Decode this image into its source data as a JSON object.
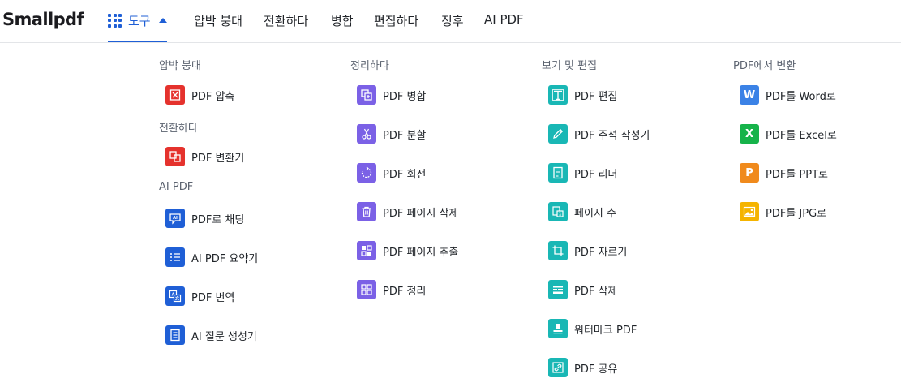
{
  "brand": {
    "logo": "Smallpdf"
  },
  "nav": {
    "tools_label": "도구",
    "items": [
      "압박 붕대",
      "전환하다",
      "병합",
      "편집하다",
      "징후",
      "AI PDF"
    ]
  },
  "menu": {
    "col1": {
      "sections": [
        {
          "title": "압박 붕대",
          "items": [
            {
              "label": "PDF 압축",
              "icon": "compress-icon"
            }
          ]
        },
        {
          "title": "전환하다",
          "items": [
            {
              "label": "PDF 변환기",
              "icon": "convert-icon"
            }
          ]
        },
        {
          "title": "AI PDF",
          "items": [
            {
              "label": "PDF로 채팅",
              "icon": "chat-ai-icon"
            },
            {
              "label": "AI PDF 요약기",
              "icon": "list-icon"
            },
            {
              "label": "PDF 번역",
              "icon": "translate-icon"
            },
            {
              "label": "AI 질문 생성기",
              "icon": "question-doc-icon"
            }
          ]
        }
      ]
    },
    "col2": {
      "title": "정리하다",
      "items": [
        {
          "label": "PDF 병합",
          "icon": "merge-icon"
        },
        {
          "label": "PDF 분할",
          "icon": "scissors-icon"
        },
        {
          "label": "PDF 회전",
          "icon": "rotate-icon"
        },
        {
          "label": "PDF 페이지 삭제",
          "icon": "trash-icon"
        },
        {
          "label": "PDF 페이지 추출",
          "icon": "extract-icon"
        },
        {
          "label": "PDF 정리",
          "icon": "organize-icon"
        }
      ]
    },
    "col3": {
      "title": "보기 및 편집",
      "items": [
        {
          "label": "PDF 편집",
          "icon": "text-icon"
        },
        {
          "label": "PDF 주석 작성기",
          "icon": "pen-icon"
        },
        {
          "label": "PDF 리더",
          "icon": "reader-icon"
        },
        {
          "label": "페이지 수",
          "icon": "page-number-icon"
        },
        {
          "label": "PDF 자르기",
          "icon": "crop-icon"
        },
        {
          "label": "PDF 삭제",
          "icon": "redact-icon"
        },
        {
          "label": "워터마크 PDF",
          "icon": "stamp-icon"
        },
        {
          "label": "PDF 공유",
          "icon": "share-icon"
        }
      ]
    },
    "col4": {
      "title": "PDF에서 변환",
      "items": [
        {
          "label": "PDF를 Word로",
          "icon": "word-icon",
          "glyph": "W"
        },
        {
          "label": "PDF를 Excel로",
          "icon": "excel-icon",
          "glyph": "X"
        },
        {
          "label": "PDF를 PPT로",
          "icon": "ppt-icon",
          "glyph": "P"
        },
        {
          "label": "PDF를 JPG로",
          "icon": "jpg-icon"
        }
      ]
    }
  },
  "colors": {
    "accent": "#1f5fd6",
    "red": "#e5322d",
    "purple": "#7b61e6",
    "teal": "#19b7b5",
    "word": "#3b82e6",
    "excel": "#16b34a",
    "ppt": "#f08a1c",
    "jpg": "#f5b400"
  }
}
